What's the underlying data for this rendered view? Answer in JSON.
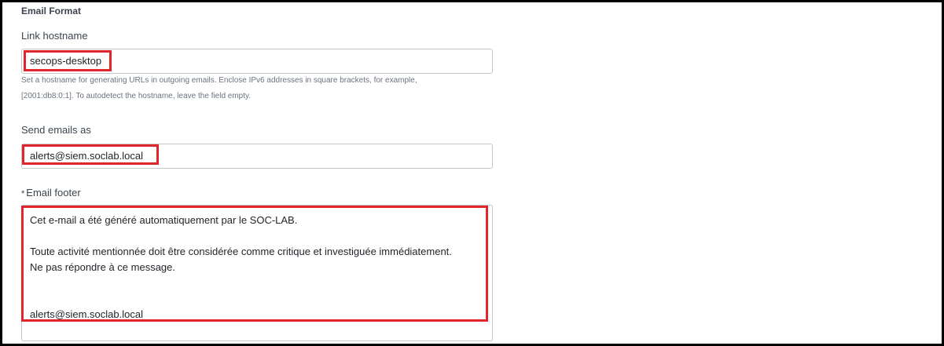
{
  "section": {
    "title": "Email Format"
  },
  "link_hostname": {
    "label": "Link hostname",
    "value": "secops-desktop",
    "help_line1": "Set a hostname for generating URLs in outgoing emails. Enclose IPv6 addresses in square brackets, for example,",
    "help_line2": "[2001:db8:0:1]. To autodetect the hostname, leave the field empty."
  },
  "send_as": {
    "label": "Send emails as",
    "value": "alerts@siem.soclab.local"
  },
  "footer": {
    "required_marker": "*",
    "label": "Email footer",
    "lines": [
      "Cet e-mail a été généré automatiquement par le SOC-LAB.",
      "",
      "Toute activité mentionnée doit être considérée comme critique et investiguée immédiatement.",
      "Ne pas répondre à ce message.",
      "",
      "",
      "alerts@siem.soclab.local"
    ]
  },
  "colors": {
    "highlight": "#e0262d",
    "frame": "#000000",
    "input_border": "#c3c7cc"
  }
}
